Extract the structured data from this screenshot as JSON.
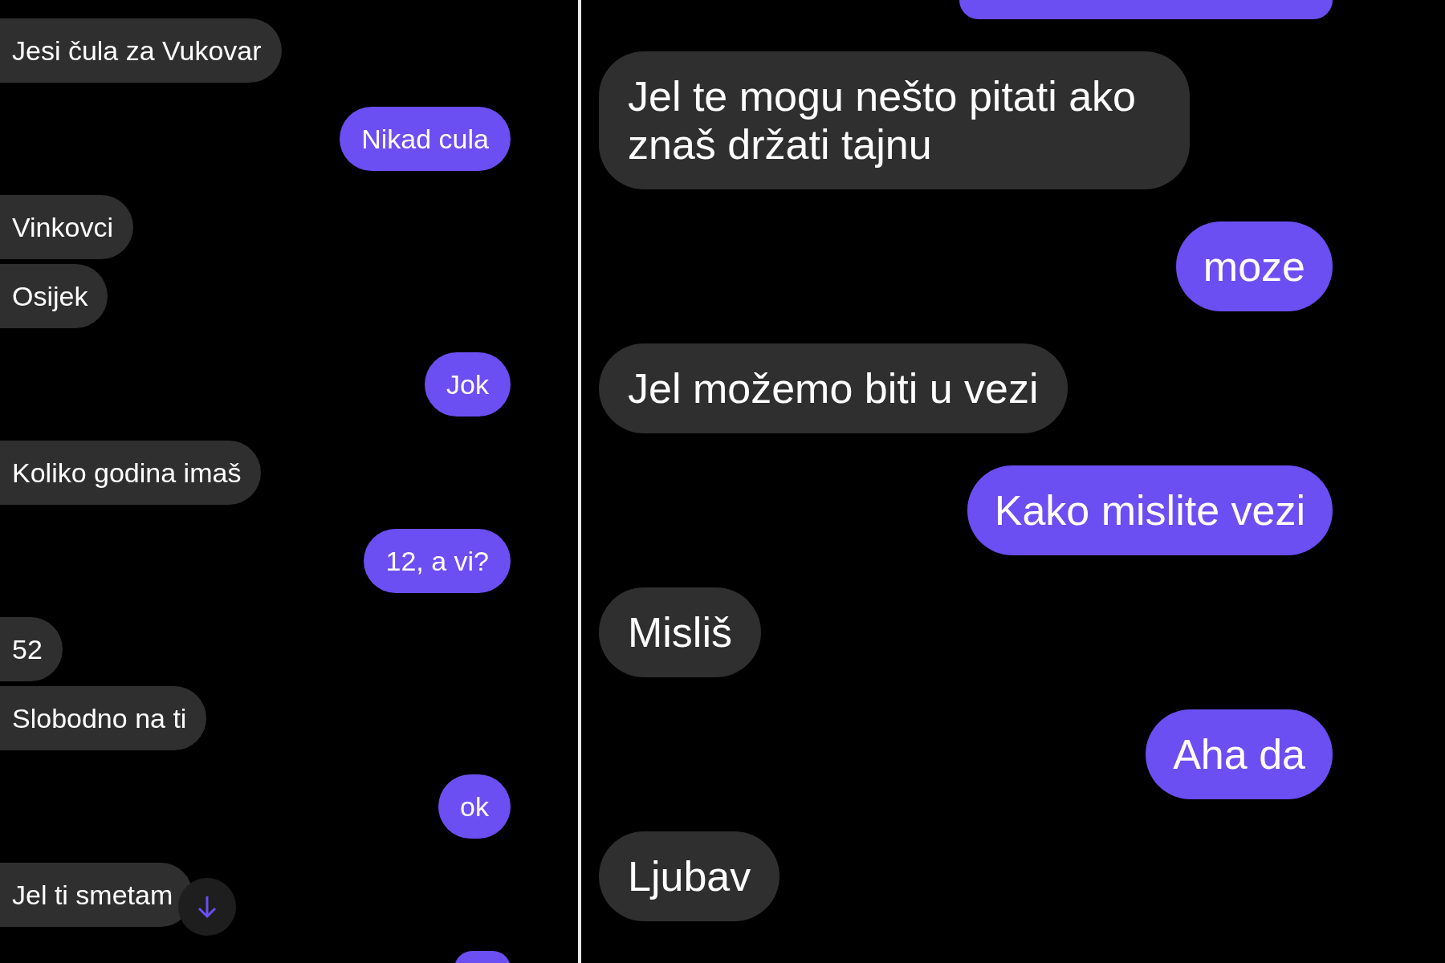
{
  "panels": [
    {
      "large_text": false,
      "scroll_down_button": true,
      "messages": [
        {
          "kind": "text",
          "outgoing": false,
          "text": "Jesi čula za Vukovar"
        },
        {
          "kind": "text",
          "outgoing": true,
          "text": "Nikad cula"
        },
        {
          "kind": "text",
          "outgoing": false,
          "text": "Vinkovci"
        },
        {
          "kind": "text",
          "outgoing": false,
          "text": "Osijek"
        },
        {
          "kind": "text",
          "outgoing": true,
          "text": "Jok"
        },
        {
          "kind": "text",
          "outgoing": false,
          "text": "Koliko godina imaš"
        },
        {
          "kind": "text",
          "outgoing": true,
          "text": "12, a vi?"
        },
        {
          "kind": "text",
          "outgoing": false,
          "text": "52"
        },
        {
          "kind": "text",
          "outgoing": false,
          "text": "Slobodno na ti"
        },
        {
          "kind": "text",
          "outgoing": true,
          "text": "ok"
        },
        {
          "kind": "text",
          "outgoing": false,
          "text": "Jel ti smetam"
        },
        {
          "kind": "cutoff",
          "outgoing": true
        }
      ]
    },
    {
      "large_text": true,
      "messages": [
        {
          "kind": "cutoff",
          "outgoing": true
        },
        {
          "kind": "text",
          "outgoing": false,
          "text": "Jel te mogu nešto pitati ako znaš držati tajnu"
        },
        {
          "kind": "text",
          "outgoing": true,
          "text": "moze"
        },
        {
          "kind": "text",
          "outgoing": false,
          "text": "Jel možemo biti u vezi"
        },
        {
          "kind": "text",
          "outgoing": true,
          "text": "Kako mislite vezi"
        },
        {
          "kind": "text",
          "outgoing": false,
          "text": "Misliš"
        },
        {
          "kind": "text",
          "outgoing": true,
          "text": "Aha da"
        },
        {
          "kind": "text",
          "outgoing": false,
          "text": "Ljubav"
        }
      ]
    }
  ]
}
